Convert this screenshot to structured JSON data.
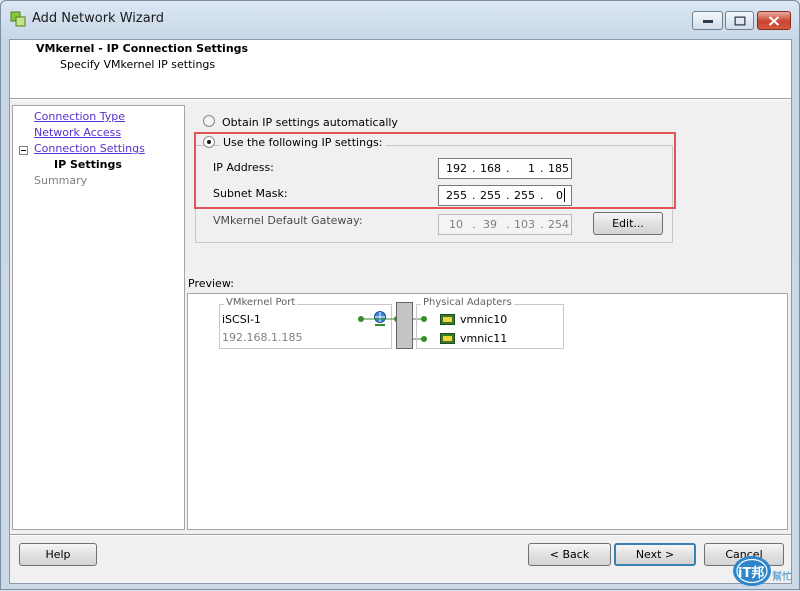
{
  "window": {
    "title": "Add Network Wizard"
  },
  "header": {
    "title": "VMkernel - IP Connection Settings",
    "subtitle": "Specify VMkernel IP settings"
  },
  "nav": {
    "items": [
      {
        "label": "Connection Type"
      },
      {
        "label": "Network Access"
      },
      {
        "label": "Connection Settings"
      },
      {
        "label": "IP Settings"
      },
      {
        "label": "Summary"
      }
    ]
  },
  "ip_settings": {
    "obtain_auto_label": "Obtain IP settings automatically",
    "use_following_label": "Use the following IP settings:",
    "selected": "use_following",
    "ip_address_label": "IP Address:",
    "ip_address": [
      "192",
      "168",
      "1",
      "185"
    ],
    "subnet_mask_label": "Subnet Mask:",
    "subnet_mask": [
      "255",
      "255",
      "255",
      "0"
    ],
    "gateway_label": "VMkernel Default Gateway:",
    "gateway": [
      "10",
      "39",
      "103",
      "254"
    ],
    "edit_label": "Edit..."
  },
  "preview": {
    "label": "Preview:",
    "port_caption": "VMkernel Port",
    "port_name": "iSCSI-1",
    "port_ip": "192.168.1.185",
    "adapters_caption": "Physical Adapters",
    "adapters": [
      {
        "name": "vmnic10"
      },
      {
        "name": "vmnic11"
      }
    ]
  },
  "buttons": {
    "help": "Help",
    "back": "< Back",
    "next": "Next >",
    "cancel": "Cancel"
  },
  "watermark": {
    "text": "iT邦",
    "subtext": "幫忙"
  },
  "colors": {
    "link": "#5a2fd0",
    "highlight_outline": "#e05656",
    "default_button_border": "#3c7fb1"
  }
}
